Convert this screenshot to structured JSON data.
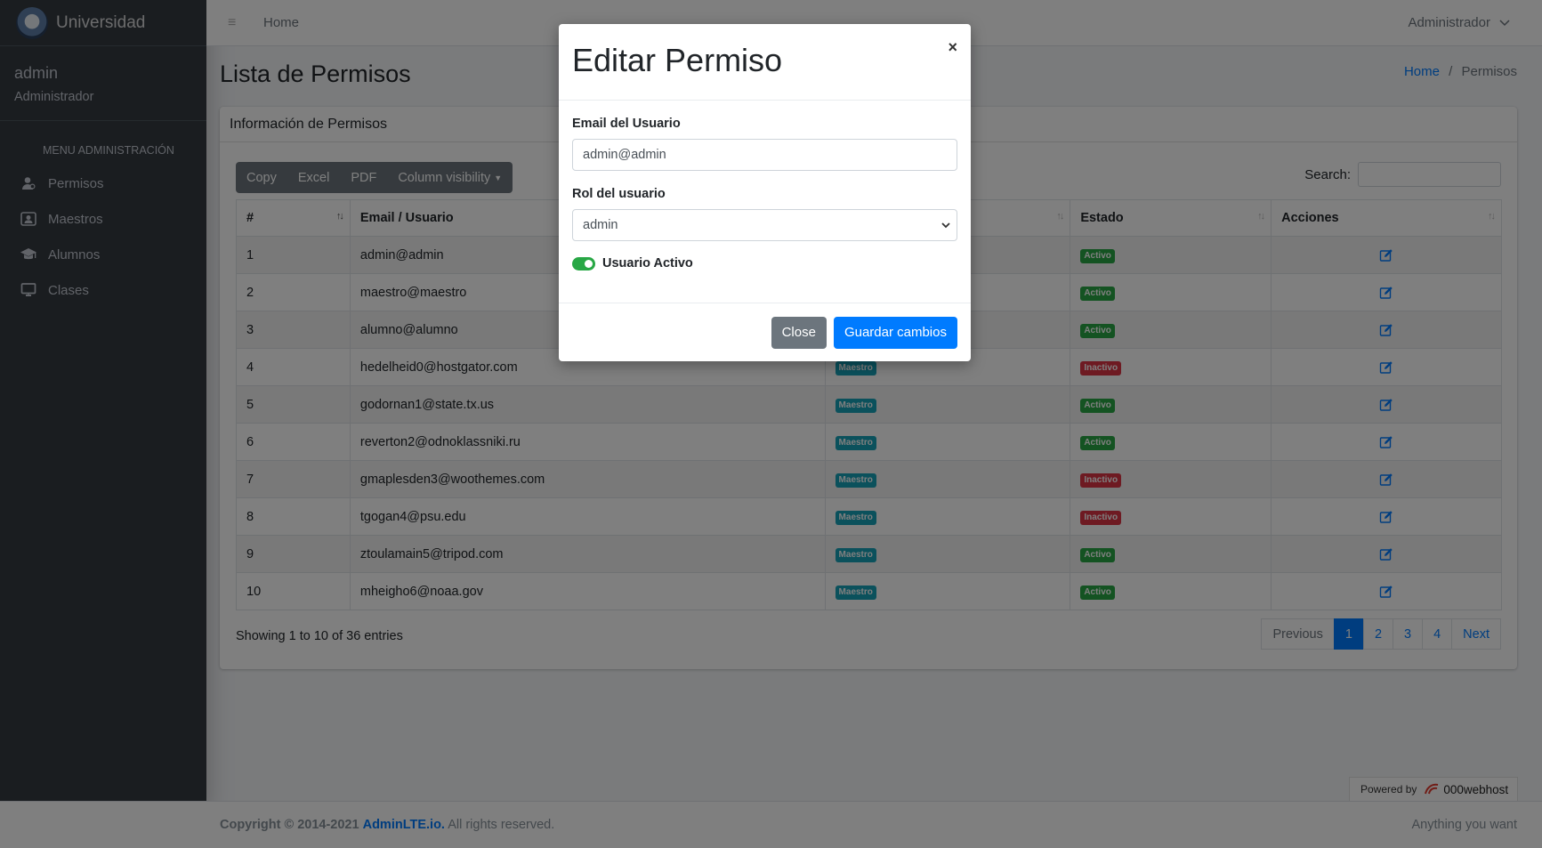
{
  "sidebar": {
    "brand": "Universidad",
    "user_name": "admin",
    "user_role": "Administrador",
    "menu_header": "MENU ADMINISTRACIÓN",
    "items": [
      {
        "label": "Permisos",
        "icon": "user-icon"
      },
      {
        "label": "Maestros",
        "icon": "id-card-icon"
      },
      {
        "label": "Alumnos",
        "icon": "graduation-cap-icon"
      },
      {
        "label": "Clases",
        "icon": "monitor-icon"
      }
    ]
  },
  "topnav": {
    "home": "Home",
    "user_menu": "Administrador"
  },
  "page": {
    "title": "Lista de Permisos",
    "breadcrumb_home": "Home",
    "breadcrumb_sep": "/",
    "breadcrumb_current": "Permisos"
  },
  "card": {
    "title": "Información de Permisos",
    "buttons": {
      "copy": "Copy",
      "excel": "Excel",
      "pdf": "PDF",
      "colvis": "Column visibility"
    },
    "search_label": "Search:",
    "search_value": ""
  },
  "table": {
    "headers": {
      "num": "#",
      "email": "Email / Usuario",
      "rol": "",
      "estado": "Estado",
      "acciones": "Acciones"
    },
    "rows": [
      {
        "num": "1",
        "email": "admin@admin",
        "rol": "",
        "estado": "Activo"
      },
      {
        "num": "2",
        "email": "maestro@maestro",
        "rol": "",
        "estado": "Activo"
      },
      {
        "num": "3",
        "email": "alumno@alumno",
        "rol": "",
        "estado": "Activo"
      },
      {
        "num": "4",
        "email": "hedelheid0@hostgator.com",
        "rol": "Maestro",
        "estado": "Inactivo"
      },
      {
        "num": "5",
        "email": "godornan1@state.tx.us",
        "rol": "Maestro",
        "estado": "Activo"
      },
      {
        "num": "6",
        "email": "reverton2@odnoklassniki.ru",
        "rol": "Maestro",
        "estado": "Activo"
      },
      {
        "num": "7",
        "email": "gmaplesden3@woothemes.com",
        "rol": "Maestro",
        "estado": "Inactivo"
      },
      {
        "num": "8",
        "email": "tgogan4@psu.edu",
        "rol": "Maestro",
        "estado": "Inactivo"
      },
      {
        "num": "9",
        "email": "ztoulamain5@tripod.com",
        "rol": "Maestro",
        "estado": "Activo"
      },
      {
        "num": "10",
        "email": "mheigho6@noaa.gov",
        "rol": "Maestro",
        "estado": "Activo"
      }
    ],
    "info": "Showing 1 to 10 of 36 entries",
    "pagination": {
      "previous": "Previous",
      "pages": [
        "1",
        "2",
        "3",
        "4"
      ],
      "next": "Next",
      "active": "1"
    }
  },
  "footer": {
    "copyright": "Copyright © 2014-2021",
    "link": "AdminLTE.io.",
    "rights": "All rights reserved.",
    "right_text": "Anything you want",
    "powered_by": "Powered by",
    "powered_brand": "000webhost"
  },
  "modal": {
    "title": "Editar Permiso",
    "close_x": "×",
    "email_label": "Email del Usuario",
    "email_value": "admin@admin",
    "rol_label": "Rol del usuario",
    "rol_value": "admin",
    "active_label": "Usuario Activo",
    "active": true,
    "btn_close": "Close",
    "btn_save": "Guardar cambios"
  },
  "colors": {
    "sidebar_bg": "#343a40",
    "primary": "#007bff",
    "success": "#28a745",
    "danger": "#dc3545",
    "info": "#17a2b8",
    "secondary": "#6c757d"
  }
}
